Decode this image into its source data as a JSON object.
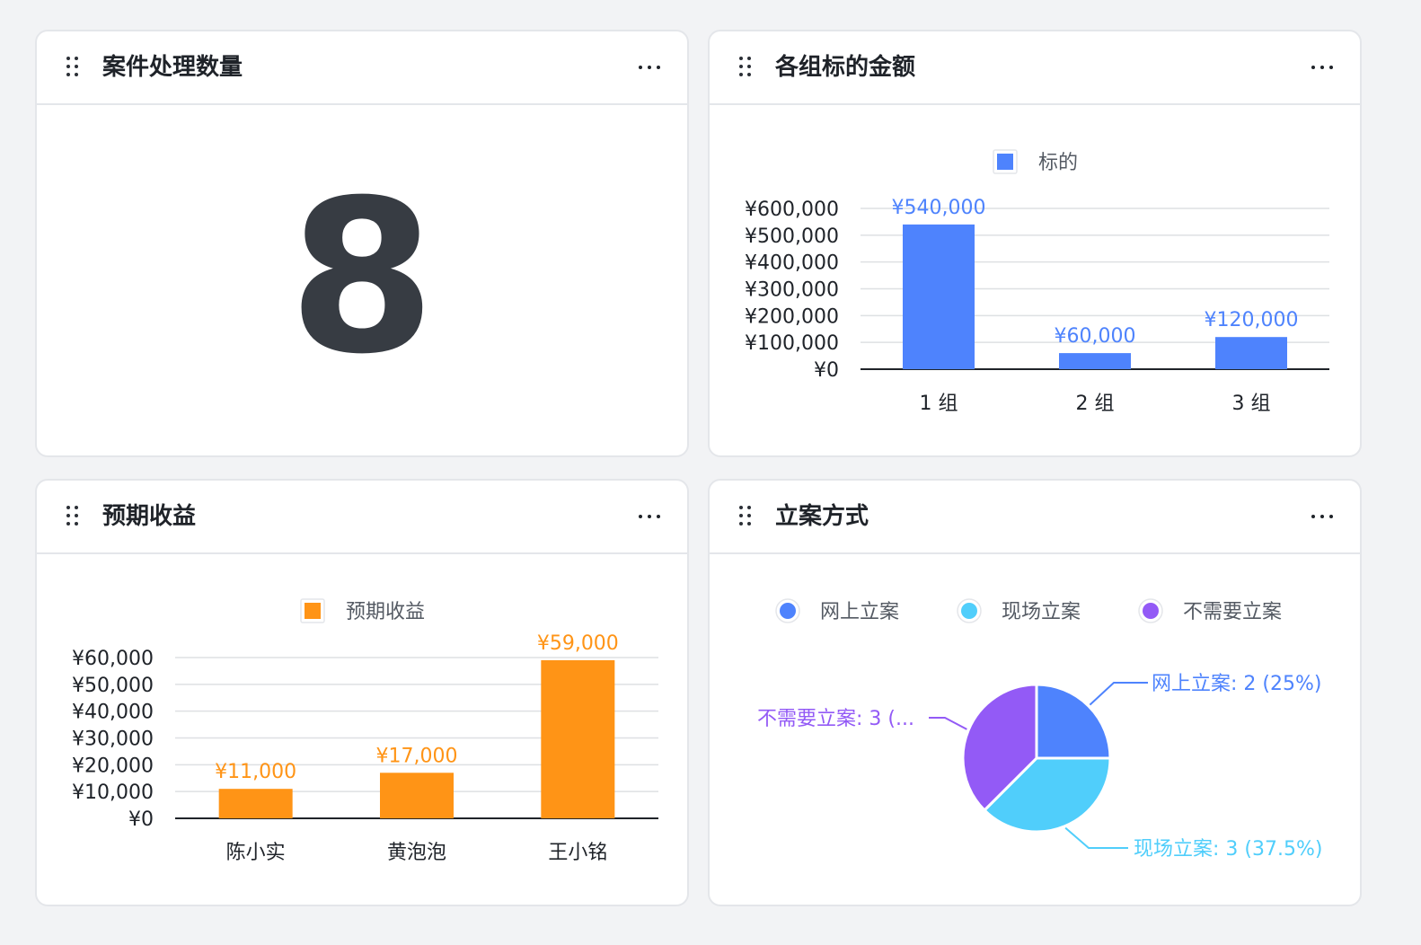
{
  "cards": {
    "case_count": {
      "title": "案件处理数量",
      "value": "8"
    },
    "group_amount": {
      "title": "各组标的金额"
    },
    "expected_income": {
      "title": "预期收益"
    },
    "filing_method": {
      "title": "立案方式"
    }
  },
  "chart_data": [
    {
      "type": "bar",
      "legend": [
        "标的"
      ],
      "categories": [
        "1 组",
        "2 组",
        "3 组"
      ],
      "series": [
        {
          "name": "标的",
          "values": [
            540000,
            60000,
            120000
          ]
        }
      ],
      "value_labels": [
        "¥540,000",
        "¥60,000",
        "¥120,000"
      ],
      "yticks": [
        "¥0",
        "¥100,000",
        "¥200,000",
        "¥300,000",
        "¥400,000",
        "¥500,000",
        "¥600,000"
      ],
      "ylim": [
        0,
        600000
      ],
      "color": "#4e83fd",
      "legend_position": "top-center",
      "grid": true
    },
    {
      "type": "bar",
      "legend": [
        "预期收益"
      ],
      "categories": [
        "陈小实",
        "黄泡泡",
        "王小铭"
      ],
      "series": [
        {
          "name": "预期收益",
          "values": [
            11000,
            17000,
            59000
          ]
        }
      ],
      "value_labels": [
        "¥11,000",
        "¥17,000",
        "¥59,000"
      ],
      "yticks": [
        "¥0",
        "¥10,000",
        "¥20,000",
        "¥30,000",
        "¥40,000",
        "¥50,000",
        "¥60,000"
      ],
      "ylim": [
        0,
        60000
      ],
      "color": "#ff9416",
      "legend_position": "top-center",
      "grid": true
    },
    {
      "type": "pie",
      "legend": [
        "网上立案",
        "现场立案",
        "不需要立案"
      ],
      "slices": [
        {
          "name": "网上立案",
          "value": 2,
          "label": "网上立案: 2 (25%)",
          "color": "#4e83fd"
        },
        {
          "name": "现场立案",
          "value": 3,
          "label": "现场立案: 3 (37.5%)",
          "color": "#50cefb"
        },
        {
          "name": "不需要立案",
          "value": 3,
          "label": "不需要立案: 3 (...",
          "color": "#935af6"
        }
      ],
      "legend_position": "top-center"
    }
  ],
  "icons": {
    "drag": "drag-handle-icon",
    "more": "more-icon"
  }
}
